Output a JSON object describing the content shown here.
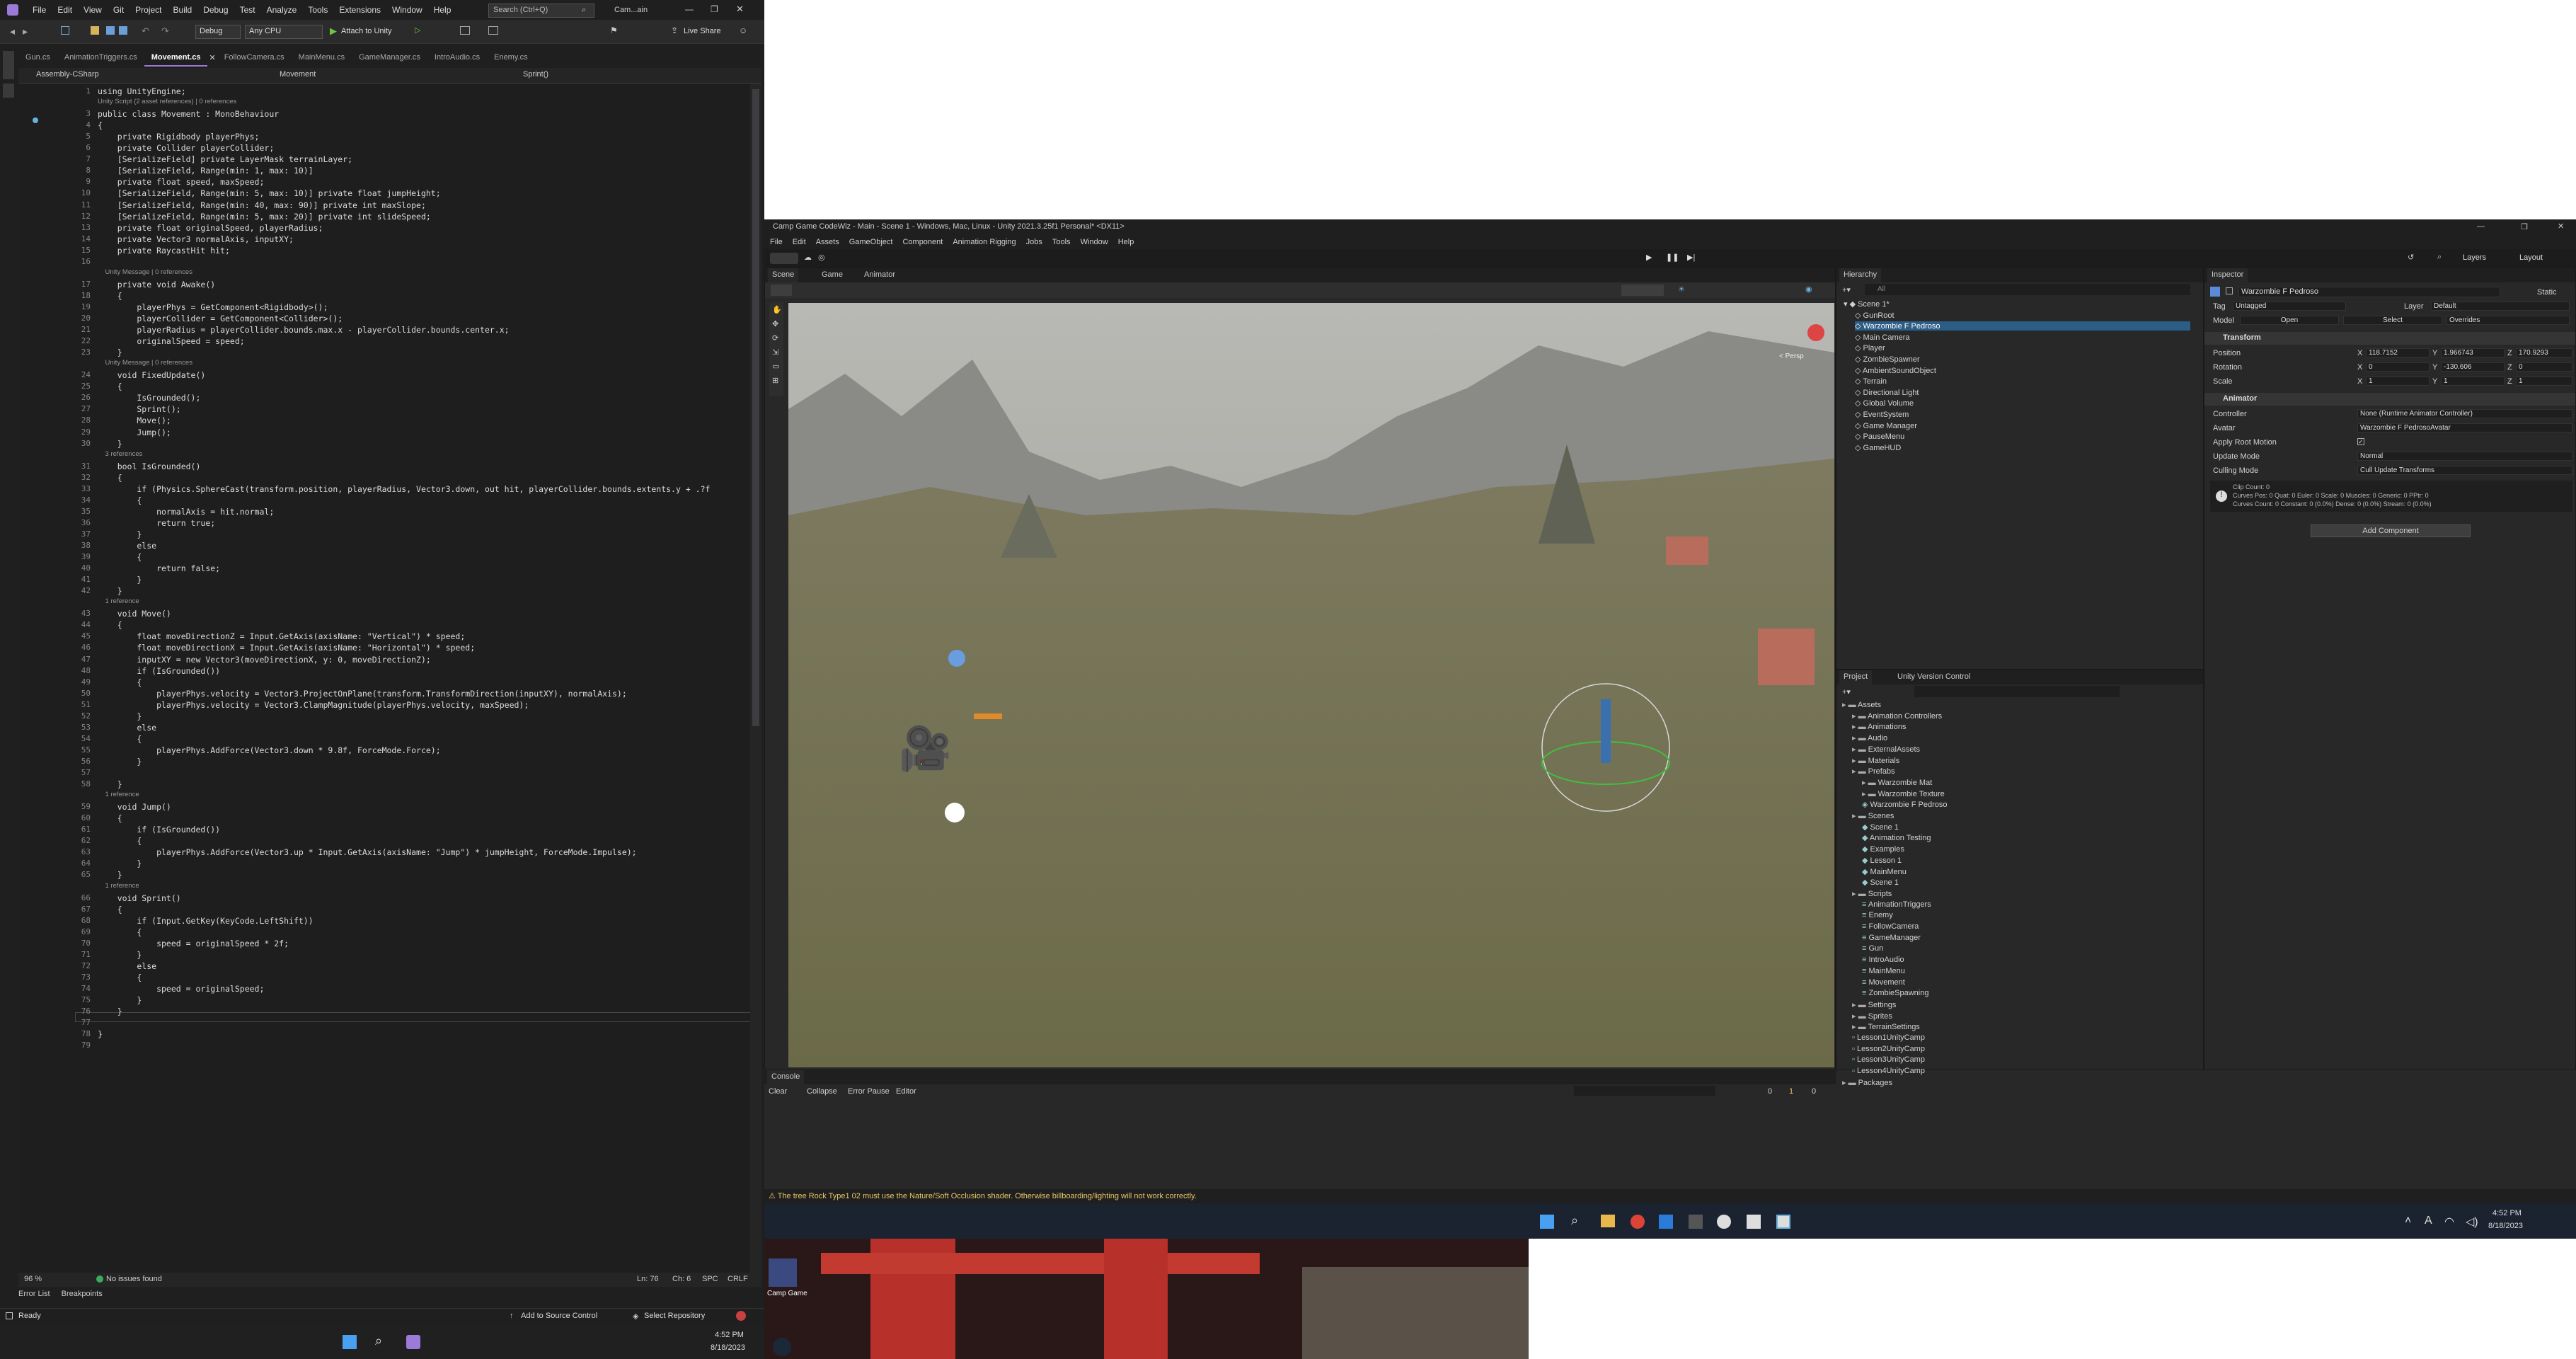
{
  "vs": {
    "menu": [
      "File",
      "Edit",
      "View",
      "Git",
      "Project",
      "Build",
      "Debug",
      "Test",
      "Analyze",
      "Tools",
      "Extensions",
      "Window",
      "Help"
    ],
    "search_placeholder": "Search (Ctrl+Q)",
    "window_title": "Cam...ain",
    "toolbar": {
      "config": "Debug",
      "platform": "Any CPU",
      "attach": "Attach to Unity",
      "live_share": "Live Share"
    },
    "tabs": [
      "Gun.cs",
      "AnimationTriggers.cs",
      "Movement.cs",
      "FollowCamera.cs",
      "MainMenu.cs",
      "GameManager.cs",
      "IntroAudio.cs",
      "Enemy.cs"
    ],
    "active_tab": "Movement.cs",
    "nav": {
      "project": "Assembly-CSharp",
      "class": "Movement",
      "member": "Sprint()"
    },
    "lines": [
      {
        "n": "1",
        "t": "using UnityEngine;"
      },
      {
        "n": "",
        "t": "Unity Script (2 asset references) | 0 references",
        "lens": true
      },
      {
        "n": "3",
        "t": "public class Movement : MonoBehaviour"
      },
      {
        "n": "4",
        "t": "{"
      },
      {
        "n": "5",
        "t": "    private Rigidbody playerPhys;"
      },
      {
        "n": "6",
        "t": "    private Collider playerCollider;"
      },
      {
        "n": "7",
        "t": "    [SerializeField] private LayerMask terrainLayer;"
      },
      {
        "n": "8",
        "t": "    [SerializeField, Range(min: 1, max: 10)]"
      },
      {
        "n": "9",
        "t": "    private float speed, maxSpeed;"
      },
      {
        "n": "10",
        "t": "    [SerializeField, Range(min: 5, max: 10)] private float jumpHeight;"
      },
      {
        "n": "11",
        "t": "    [SerializeField, Range(min: 40, max: 90)] private int maxSlope;"
      },
      {
        "n": "12",
        "t": "    [SerializeField, Range(min: 5, max: 20)] private int slideSpeed;"
      },
      {
        "n": "13",
        "t": "    private float originalSpeed, playerRadius;"
      },
      {
        "n": "14",
        "t": "    private Vector3 normalAxis, inputXY;"
      },
      {
        "n": "15",
        "t": "    private RaycastHit hit;"
      },
      {
        "n": "16",
        "t": ""
      },
      {
        "n": "",
        "t": "    Unity Message | 0 references",
        "lens": true
      },
      {
        "n": "17",
        "t": "    private void Awake()"
      },
      {
        "n": "18",
        "t": "    {"
      },
      {
        "n": "19",
        "t": "        playerPhys = GetComponent<Rigidbody>();"
      },
      {
        "n": "20",
        "t": "        playerCollider = GetComponent<Collider>();"
      },
      {
        "n": "21",
        "t": "        playerRadius = playerCollider.bounds.max.x - playerCollider.bounds.center.x;"
      },
      {
        "n": "22",
        "t": "        originalSpeed = speed;"
      },
      {
        "n": "23",
        "t": "    }"
      },
      {
        "n": "",
        "t": "    Unity Message | 0 references",
        "lens": true
      },
      {
        "n": "24",
        "t": "    void FixedUpdate()"
      },
      {
        "n": "25",
        "t": "    {"
      },
      {
        "n": "26",
        "t": "        IsGrounded();"
      },
      {
        "n": "27",
        "t": "        Sprint();"
      },
      {
        "n": "28",
        "t": "        Move();"
      },
      {
        "n": "29",
        "t": "        Jump();"
      },
      {
        "n": "30",
        "t": "    }"
      },
      {
        "n": "",
        "t": "    3 references",
        "lens": true
      },
      {
        "n": "31",
        "t": "    bool IsGrounded()"
      },
      {
        "n": "32",
        "t": "    {"
      },
      {
        "n": "33",
        "t": "        if (Physics.SphereCast(transform.position, playerRadius, Vector3.down, out hit, playerCollider.bounds.extents.y + .?f"
      },
      {
        "n": "34",
        "t": "        {"
      },
      {
        "n": "35",
        "t": "            normalAxis = hit.normal;"
      },
      {
        "n": "36",
        "t": "            return true;"
      },
      {
        "n": "37",
        "t": "        }"
      },
      {
        "n": "38",
        "t": "        else"
      },
      {
        "n": "39",
        "t": "        {"
      },
      {
        "n": "40",
        "t": "            return false;"
      },
      {
        "n": "41",
        "t": "        }"
      },
      {
        "n": "42",
        "t": "    }"
      },
      {
        "n": "",
        "t": "    1 reference",
        "lens": true
      },
      {
        "n": "43",
        "t": "    void Move()"
      },
      {
        "n": "44",
        "t": "    {"
      },
      {
        "n": "45",
        "t": "        float moveDirectionZ = Input.GetAxis(axisName: \"Vertical\") * speed;"
      },
      {
        "n": "46",
        "t": "        float moveDirectionX = Input.GetAxis(axisName: \"Horizontal\") * speed;"
      },
      {
        "n": "47",
        "t": "        inputXY = new Vector3(moveDirectionX, y: 0, moveDirectionZ);"
      },
      {
        "n": "48",
        "t": "        if (IsGrounded())"
      },
      {
        "n": "49",
        "t": "        {"
      },
      {
        "n": "50",
        "t": "            playerPhys.velocity = Vector3.ProjectOnPlane(transform.TransformDirection(inputXY), normalAxis);"
      },
      {
        "n": "51",
        "t": "            playerPhys.velocity = Vector3.ClampMagnitude(playerPhys.velocity, maxSpeed);"
      },
      {
        "n": "52",
        "t": "        }"
      },
      {
        "n": "53",
        "t": "        else"
      },
      {
        "n": "54",
        "t": "        {"
      },
      {
        "n": "55",
        "t": "            playerPhys.AddForce(Vector3.down * 9.8f, ForceMode.Force);"
      },
      {
        "n": "56",
        "t": "        }"
      },
      {
        "n": "57",
        "t": ""
      },
      {
        "n": "58",
        "t": "    }"
      },
      {
        "n": "",
        "t": "    1 reference",
        "lens": true
      },
      {
        "n": "59",
        "t": "    void Jump()"
      },
      {
        "n": "60",
        "t": "    {"
      },
      {
        "n": "61",
        "t": "        if (IsGrounded())"
      },
      {
        "n": "62",
        "t": "        {"
      },
      {
        "n": "63",
        "t": "            playerPhys.AddForce(Vector3.up * Input.GetAxis(axisName: \"Jump\") * jumpHeight, ForceMode.Impulse);"
      },
      {
        "n": "64",
        "t": "        }"
      },
      {
        "n": "65",
        "t": "    }"
      },
      {
        "n": "",
        "t": "    1 reference",
        "lens": true
      },
      {
        "n": "66",
        "t": "    void Sprint()"
      },
      {
        "n": "67",
        "t": "    {"
      },
      {
        "n": "68",
        "t": "        if (Input.GetKey(KeyCode.LeftShift))"
      },
      {
        "n": "69",
        "t": "        {"
      },
      {
        "n": "70",
        "t": "            speed = originalSpeed * 2f;"
      },
      {
        "n": "71",
        "t": "        }"
      },
      {
        "n": "72",
        "t": "        else"
      },
      {
        "n": "73",
        "t": "        {"
      },
      {
        "n": "74",
        "t": "            speed = originalSpeed;"
      },
      {
        "n": "75",
        "t": "        }"
      },
      {
        "n": "76",
        "t": "    }"
      },
      {
        "n": "77",
        "t": ""
      },
      {
        "n": "78",
        "t": "}"
      },
      {
        "n": "79",
        "t": ""
      }
    ],
    "status": {
      "zoom": "96 %",
      "issues": "No issues found",
      "ln": "Ln: 76",
      "ch": "Ch: 6",
      "spc": "SPC",
      "crlf": "CRLF"
    },
    "bottom_tabs": [
      "Error List",
      "Breakpoints"
    ],
    "statusbar": {
      "ready": "Ready",
      "source_control": "Add to Source Control",
      "repo": "Select Repository"
    },
    "clock": {
      "time": "4:52 PM",
      "date": "8/18/2023"
    }
  },
  "unity": {
    "title": "Camp Game CodeWiz - Main - Scene 1 - Windows, Mac, Linux - Unity 2021.3.25f1 Personal* <DX11>",
    "menu": [
      "File",
      "Edit",
      "Assets",
      "GameObject",
      "Component",
      "Animation Rigging",
      "Jobs",
      "Tools",
      "Window",
      "Help"
    ],
    "layers": "Layers",
    "layout": "Layout",
    "view_tabs": [
      "Scene",
      "Game",
      "Animator"
    ],
    "persp": "< Persp",
    "hierarchy": {
      "title": "Hierarchy",
      "search": "All",
      "items": [
        {
          "label": "Scene 1*",
          "indent": 0
        },
        {
          "label": "GunRoot",
          "indent": 1
        },
        {
          "label": "Warzombie F Pedroso",
          "indent": 1,
          "sel": true
        },
        {
          "label": "Main Camera",
          "indent": 1
        },
        {
          "label": "Player",
          "indent": 1
        },
        {
          "label": "ZombieSpawner",
          "indent": 1
        },
        {
          "label": "AmbientSoundObject",
          "indent": 1
        },
        {
          "label": "Terrain",
          "indent": 1
        },
        {
          "label": "Directional Light",
          "indent": 1
        },
        {
          "label": "Global Volume",
          "indent": 1
        },
        {
          "label": "EventSystem",
          "indent": 1
        },
        {
          "label": "Game Manager",
          "indent": 1
        },
        {
          "label": "PauseMenu",
          "indent": 1
        },
        {
          "label": "GameHUD",
          "indent": 1
        }
      ]
    },
    "inspector": {
      "title": "Inspector",
      "object_name": "Warzombie F Pedroso",
      "static": "Static",
      "tag_label": "Tag",
      "tag": "Untagged",
      "layer_label": "Layer",
      "layer": "Default",
      "model_label": "Model",
      "open": "Open",
      "select": "Select",
      "overrides": "Overrides",
      "transform": "Transform",
      "position": {
        "label": "Position",
        "x": "118.7152",
        "y": "1.966743",
        "z": "170.9293"
      },
      "rotation": {
        "label": "Rotation",
        "x": "0",
        "y": "-130.606",
        "z": "0"
      },
      "scale": {
        "label": "Scale",
        "x": "1",
        "y": "1",
        "z": "1"
      },
      "animator": "Animator",
      "controller_label": "Controller",
      "controller": "None (Runtime Animator Controller)",
      "avatar_label": "Avatar",
      "avatar": "Warzombie F PedrosoAvatar",
      "root_motion_label": "Apply Root Motion",
      "update_mode_label": "Update Mode",
      "update_mode": "Normal",
      "culling_label": "Culling Mode",
      "culling": "Cull Update Transforms",
      "info1": "Clip Count: 0",
      "info2": "Curves Pos: 0 Quat: 0 Euler: 0 Scale: 0 Muscles: 0 Generic: 0 PPtr: 0",
      "info3": "Curves Count: 0 Constant: 0 (0.0%) Dense: 0 (0.0%) Stream: 0 (0.0%)",
      "add_component": "Add Component"
    },
    "project": {
      "tabs": [
        "Project",
        "Unity Version Control"
      ],
      "items": [
        {
          "label": "Assets",
          "indent": 0,
          "type": "folder"
        },
        {
          "label": "Animation Controllers",
          "indent": 1,
          "type": "folder"
        },
        {
          "label": "Animations",
          "indent": 1,
          "type": "folder"
        },
        {
          "label": "Audio",
          "indent": 1,
          "type": "folder"
        },
        {
          "label": "ExternalAssets",
          "indent": 1,
          "type": "folder"
        },
        {
          "label": "Materials",
          "indent": 1,
          "type": "folder"
        },
        {
          "label": "Prefabs",
          "indent": 1,
          "type": "folder"
        },
        {
          "label": "Warzombie Mat",
          "indent": 2,
          "type": "folder"
        },
        {
          "label": "Warzombie Texture",
          "indent": 2,
          "type": "folder"
        },
        {
          "label": "Warzombie F Pedroso",
          "indent": 2,
          "type": "prefab"
        },
        {
          "label": "Scenes",
          "indent": 1,
          "type": "folder"
        },
        {
          "label": "Scene 1",
          "indent": 2,
          "type": "scene"
        },
        {
          "label": "Animation Testing",
          "indent": 2,
          "type": "scene"
        },
        {
          "label": "Examples",
          "indent": 2,
          "type": "scene"
        },
        {
          "label": "Lesson 1",
          "indent": 2,
          "type": "scene"
        },
        {
          "label": "MainMenu",
          "indent": 2,
          "type": "scene"
        },
        {
          "label": "Scene 1",
          "indent": 2,
          "type": "scene"
        },
        {
          "label": "Scripts",
          "indent": 1,
          "type": "folder"
        },
        {
          "label": "AnimationTriggers",
          "indent": 2,
          "type": "script"
        },
        {
          "label": "Enemy",
          "indent": 2,
          "type": "script"
        },
        {
          "label": "FollowCamera",
          "indent": 2,
          "type": "script"
        },
        {
          "label": "GameManager",
          "indent": 2,
          "type": "script"
        },
        {
          "label": "Gun",
          "indent": 2,
          "type": "script"
        },
        {
          "label": "IntroAudio",
          "indent": 2,
          "type": "script"
        },
        {
          "label": "MainMenu",
          "indent": 2,
          "type": "script"
        },
        {
          "label": "Movement",
          "indent": 2,
          "type": "script"
        },
        {
          "label": "ZombieSpawning",
          "indent": 2,
          "type": "script"
        },
        {
          "label": "Settings",
          "indent": 1,
          "type": "folder"
        },
        {
          "label": "Sprites",
          "indent": 1,
          "type": "folder"
        },
        {
          "label": "TerrainSettings",
          "indent": 1,
          "type": "folder"
        },
        {
          "label": "Lesson1UnityCamp",
          "indent": 1,
          "type": "file"
        },
        {
          "label": "Lesson2UnityCamp",
          "indent": 1,
          "type": "file"
        },
        {
          "label": "Lesson3UnityCamp",
          "indent": 1,
          "type": "file"
        },
        {
          "label": "Lesson4UnityCamp",
          "indent": 1,
          "type": "file"
        },
        {
          "label": "Packages",
          "indent": 0,
          "type": "folder"
        }
      ]
    },
    "console": {
      "title": "Console",
      "clear": "Clear",
      "collapse": "Collapse",
      "error_pause": "Error Pause",
      "editor": "Editor",
      "c0": "0",
      "c1": "1",
      "c2": "0"
    },
    "warning": "The tree Rock Type1 02 must use the Nature/Soft Occlusion shader. Otherwise billboarding/lighting will not work correctly.",
    "clock": {
      "time": "4:52 PM",
      "date": "8/18/2023"
    },
    "desktop_label": "Camp Game"
  },
  "colors": {
    "keyword": "#569cd6",
    "type": "#4ec9b0",
    "string": "#d69d85",
    "method": "#dcdcaa",
    "accent": "#9b7ad8",
    "unity_sel": "#2c5d87"
  }
}
